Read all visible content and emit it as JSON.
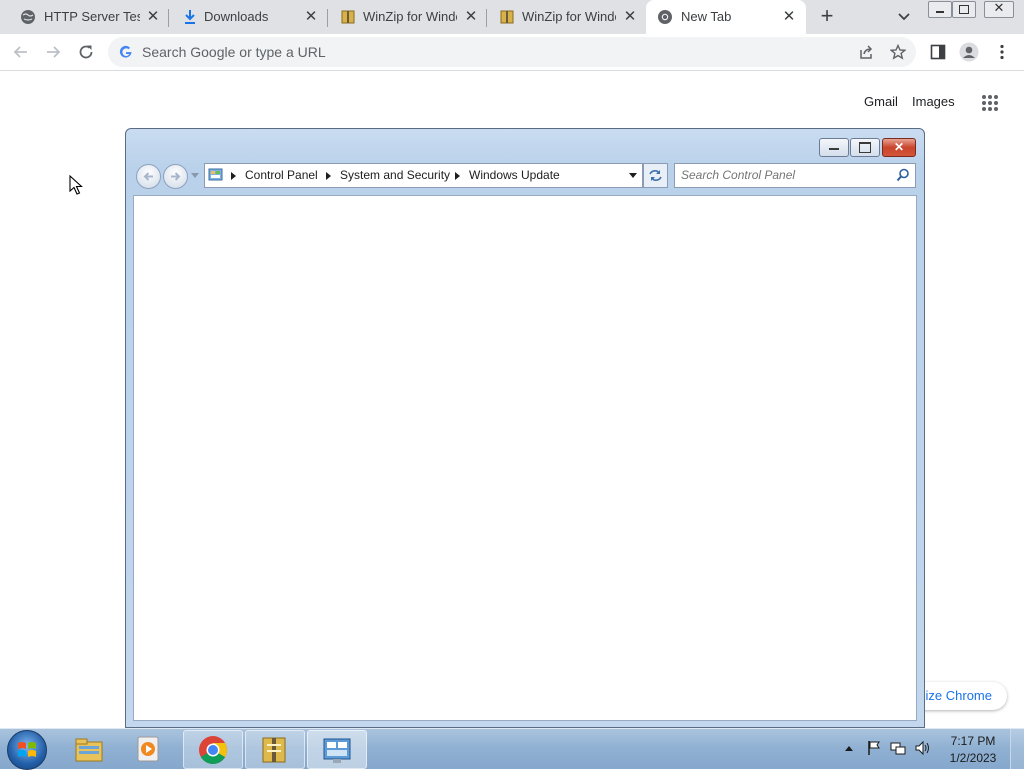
{
  "browser": {
    "tabs": [
      {
        "title": "HTTP Server Test |",
        "icon": "globe-icon",
        "active": false
      },
      {
        "title": "Downloads",
        "icon": "download-icon",
        "active": false
      },
      {
        "title": "WinZip for Windo",
        "icon": "winzip-icon",
        "active": false
      },
      {
        "title": "WinZip for Windo",
        "icon": "winzip-icon",
        "active": false
      },
      {
        "title": "New Tab",
        "icon": "chrome-icon",
        "active": true
      }
    ],
    "omnibox": {
      "placeholder": "Search Google or type a URL"
    },
    "colors": {
      "tabstrip": "#dfe1e5",
      "omnibox": "#f1f3f4",
      "accent": "#1a73e8"
    }
  },
  "ntp": {
    "gmail": "Gmail",
    "images": "Images",
    "customize": "Customize Chrome"
  },
  "explorer": {
    "breadcrumb": [
      "Control Panel",
      "System and Security",
      "Windows Update"
    ],
    "search_placeholder": "Search Control Panel"
  },
  "taskbar": {
    "apps": [
      "explorer-icon",
      "media-player-icon",
      "chrome-icon",
      "winzip-icon",
      "control-panel-icon"
    ],
    "clock": {
      "time": "7:17 PM",
      "date": "1/2/2023"
    }
  }
}
